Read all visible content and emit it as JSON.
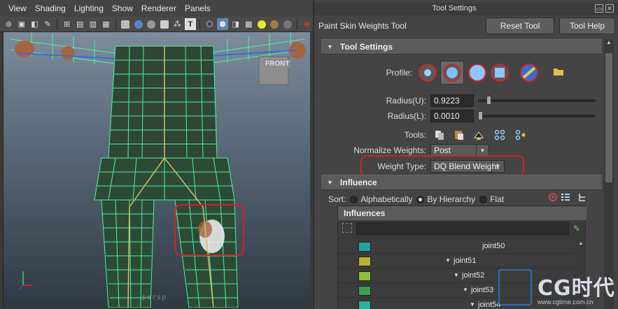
{
  "viewport": {
    "menu": [
      "View",
      "Shading",
      "Lighting",
      "Show",
      "Renderer",
      "Panels"
    ],
    "camera_label": "persp",
    "view_cube_label": "FRONT"
  },
  "panel": {
    "title": "Tool Settings",
    "tool_name": "Paint Skin Weights Tool",
    "reset_label": "Reset Tool",
    "help_label": "Tool Help",
    "tool_settings": {
      "header": "Tool Settings",
      "profile_label": "Profile:",
      "radius_u_label": "Radius(U):",
      "radius_u_value": "0.9223",
      "radius_u_level": 0.07,
      "radius_l_label": "Radius(L):",
      "radius_l_value": "0.0010",
      "radius_l_level": 0.0,
      "tools_label": "Tools:",
      "normalize_label": "Normalize Weights:",
      "normalize_value": "Post",
      "weight_type_label": "Weight Type:",
      "weight_type_value": "DQ Blend Weight"
    },
    "influence": {
      "header": "Influence",
      "sort_label": "Sort:",
      "sort_options": [
        "Alphabetically",
        "By Hierarchy",
        "Flat"
      ],
      "sort_selected": "By Hierarchy",
      "list_header": "Influences",
      "items": [
        {
          "name": "joint50",
          "color": "#1fa4a4"
        },
        {
          "name": "joint51",
          "color": "#b5b530"
        },
        {
          "name": "joint52",
          "color": "#8fbf3a"
        },
        {
          "name": "joint53",
          "color": "#3aa04e"
        },
        {
          "name": "joint54",
          "color": "#2bb098"
        }
      ]
    }
  },
  "colors": {
    "wireframe": "#4cf59a",
    "annotation": "#d4202a",
    "selected_tool": "#5f86b5"
  },
  "watermark": {
    "text": "CG时代",
    "url": "www.cgtime.com.cn"
  }
}
